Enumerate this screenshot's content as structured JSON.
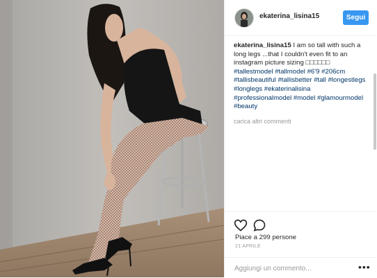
{
  "post": {
    "image_alt": "photo of a tall woman in a black bodysuit and fishnet tights sitting on a bar stool"
  },
  "header": {
    "username": "ekaterina_lisina15",
    "follow_label": "Segui"
  },
  "caption": {
    "author": "ekaterina_lisina15",
    "text": "I am so tall with such a long legs ...that I couldn't even fit to an instagram picture sizing □□□□□□",
    "hashtags": "#tallestmodel #tallmodel #6'9 #206cm #tallisbeautiful #tallisbetter #tall #longestlegs #longlegs #ekaterinalisina #professionalmodel #model #glamourmodel #beauty",
    "load_more": "carica altri commenti"
  },
  "actions": {
    "like_icon": "heart-icon",
    "comment_icon": "comment-icon",
    "likes_text": "Piace a 299 persone",
    "date": "21 APRILE"
  },
  "comment_box": {
    "placeholder": "Aggiungi un commento...",
    "more_icon": "ellipsis-icon"
  },
  "colors": {
    "accent": "#3897f0",
    "hashtag": "#003569",
    "muted": "#999999",
    "text": "#262626"
  }
}
